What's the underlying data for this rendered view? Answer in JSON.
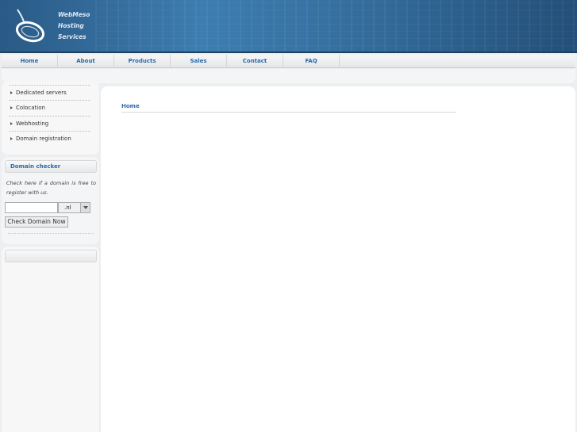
{
  "header": {
    "brand_lines": [
      "WebMeso",
      "Hosting",
      "Services"
    ],
    "logo_icon": "mouse-icon"
  },
  "nav": {
    "items": [
      "Home",
      "About",
      "Products",
      "Sales",
      "Contact",
      "FAQ"
    ],
    "color": "#2a6aa8"
  },
  "sidebar": {
    "menu": [
      "Dedicated servers",
      "Colocation",
      "Webhosting",
      "Domain registration"
    ],
    "domain_checker": {
      "title": "Domain checker",
      "description": "Check here if a domain is free to register with us.",
      "input_value": "",
      "tld_selected": ".nl",
      "button_label": "Check Domain Now"
    }
  },
  "main": {
    "breadcrumb": "Home"
  }
}
